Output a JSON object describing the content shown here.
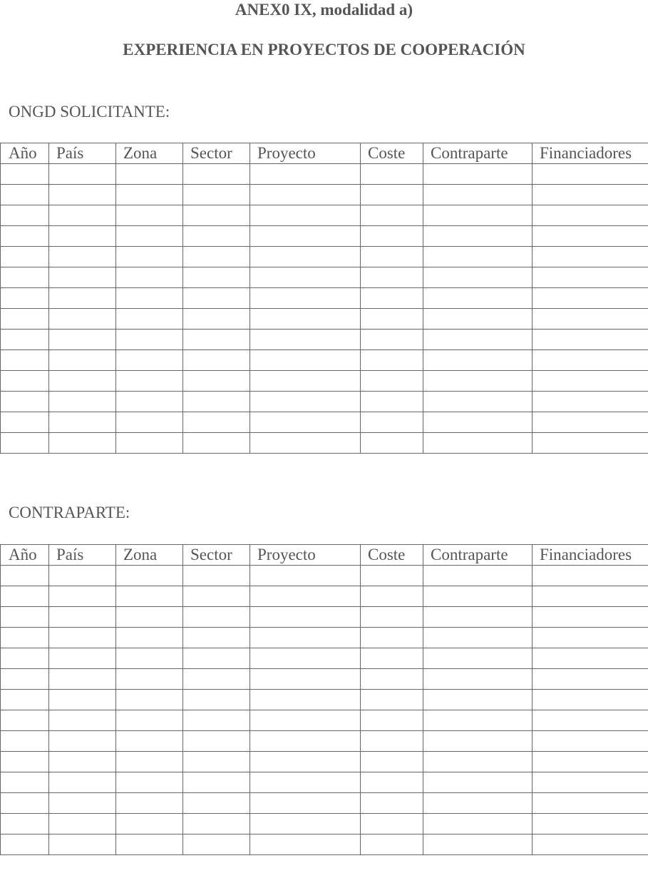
{
  "document": {
    "title": "ANEX0 IX, modalidad a)",
    "subtitle": "EXPERIENCIA EN PROYECTOS DE COOPERACIÓN"
  },
  "columns": [
    "Año",
    "País",
    "Zona",
    "Sector",
    "Proyecto",
    "Coste",
    "Contraparte",
    "Financiadores"
  ],
  "sections": [
    {
      "label": "ONGD SOLICITANTE:",
      "rows": [
        [
          "",
          "",
          "",
          "",
          "",
          "",
          "",
          ""
        ],
        [
          "",
          "",
          "",
          "",
          "",
          "",
          "",
          ""
        ],
        [
          "",
          "",
          "",
          "",
          "",
          "",
          "",
          ""
        ],
        [
          "",
          "",
          "",
          "",
          "",
          "",
          "",
          ""
        ],
        [
          "",
          "",
          "",
          "",
          "",
          "",
          "",
          ""
        ],
        [
          "",
          "",
          "",
          "",
          "",
          "",
          "",
          ""
        ],
        [
          "",
          "",
          "",
          "",
          "",
          "",
          "",
          ""
        ],
        [
          "",
          "",
          "",
          "",
          "",
          "",
          "",
          ""
        ],
        [
          "",
          "",
          "",
          "",
          "",
          "",
          "",
          ""
        ],
        [
          "",
          "",
          "",
          "",
          "",
          "",
          "",
          ""
        ],
        [
          "",
          "",
          "",
          "",
          "",
          "",
          "",
          ""
        ],
        [
          "",
          "",
          "",
          "",
          "",
          "",
          "",
          ""
        ],
        [
          "",
          "",
          "",
          "",
          "",
          "",
          "",
          ""
        ],
        [
          "",
          "",
          "",
          "",
          "",
          "",
          "",
          ""
        ]
      ]
    },
    {
      "label": "CONTRAPARTE:",
      "rows": [
        [
          "",
          "",
          "",
          "",
          "",
          "",
          "",
          ""
        ],
        [
          "",
          "",
          "",
          "",
          "",
          "",
          "",
          ""
        ],
        [
          "",
          "",
          "",
          "",
          "",
          "",
          "",
          ""
        ],
        [
          "",
          "",
          "",
          "",
          "",
          "",
          "",
          ""
        ],
        [
          "",
          "",
          "",
          "",
          "",
          "",
          "",
          ""
        ],
        [
          "",
          "",
          "",
          "",
          "",
          "",
          "",
          ""
        ],
        [
          "",
          "",
          "",
          "",
          "",
          "",
          "",
          ""
        ],
        [
          "",
          "",
          "",
          "",
          "",
          "",
          "",
          ""
        ],
        [
          "",
          "",
          "",
          "",
          "",
          "",
          "",
          ""
        ],
        [
          "",
          "",
          "",
          "",
          "",
          "",
          "",
          ""
        ],
        [
          "",
          "",
          "",
          "",
          "",
          "",
          "",
          ""
        ],
        [
          "",
          "",
          "",
          "",
          "",
          "",
          "",
          ""
        ],
        [
          "",
          "",
          "",
          "",
          "",
          "",
          "",
          ""
        ],
        [
          "",
          "",
          "",
          "",
          "",
          "",
          "",
          ""
        ]
      ]
    }
  ]
}
